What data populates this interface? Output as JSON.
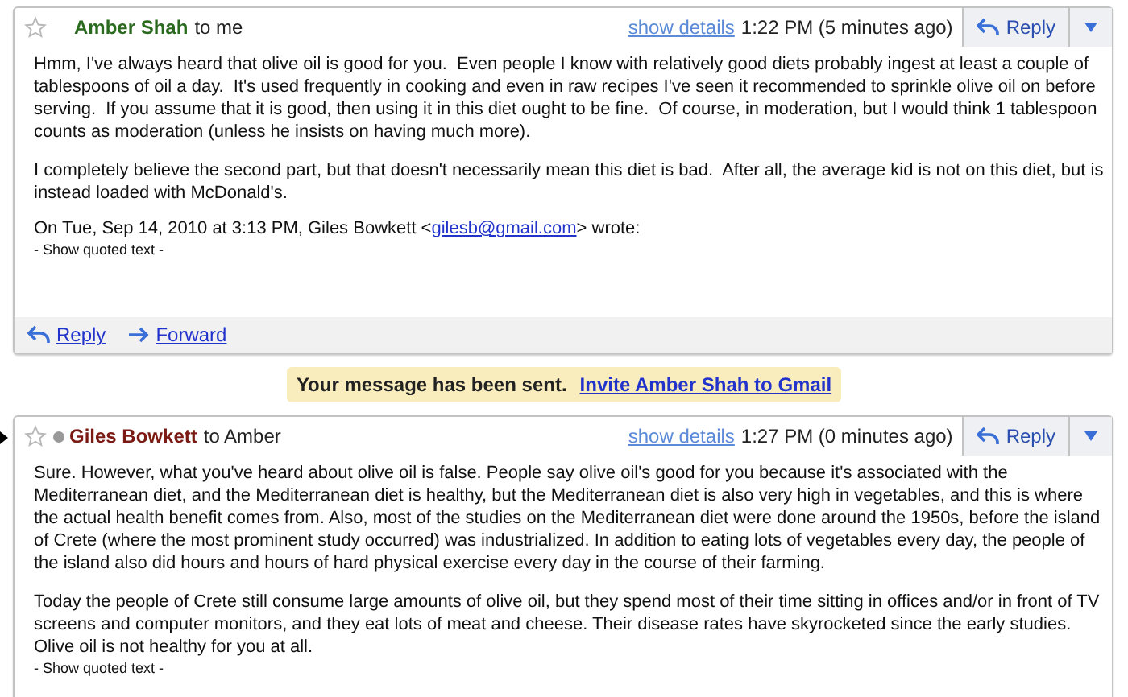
{
  "messages": [
    {
      "sender": "Amber Shah",
      "color": "#2a6a1e",
      "recipient": "to me",
      "starred": false,
      "current": false,
      "presence": false,
      "show_details": "show details",
      "time": "1:22 PM (5 minutes ago)",
      "reply_button": "Reply",
      "paragraphs": [
        "Hmm, I've always heard that olive oil is good for you.  Even people I know with relatively good diets probably ingest at least a couple of tablespoons of oil a day.  It's used frequently in cooking and even in raw recipes I've seen it recommended to sprinkle olive oil on before serving.  If you assume that it is good, then using it in this diet ought to be fine.  Of course, in moderation, but I would think 1 tablespoon counts as moderation (unless he insists on having much more).",
        "I completely believe the second part, but that doesn't necessarily mean this diet is bad.  After all, the average kid is not on this diet, but is instead loaded with McDonald's."
      ],
      "attribution": {
        "before": "On Tue, Sep 14, 2010 at 3:13 PM, Giles Bowkett <",
        "email": "gilesb@gmail.com",
        "after": "> wrote:"
      },
      "show_quoted": "- Show quoted text -",
      "actions": [
        "Reply",
        "Forward"
      ]
    },
    {
      "sender": "Giles Bowkett",
      "color": "#7a1a12",
      "recipient": "to Amber",
      "starred": false,
      "current": true,
      "presence": true,
      "show_details": "show details",
      "time": "1:27 PM (0 minutes ago)",
      "reply_button": "Reply",
      "paragraphs": [
        "Sure. However, what you've heard about olive oil is false. People say olive oil's good for you because it's associated with the Mediterranean diet, and the Mediterranean diet is healthy, but the Mediterranean diet is also very high in vegetables, and this is where the actual health benefit comes from. Also, most of the studies on the Mediterranean diet were done around the 1950s, before the island of Crete (where the most prominent study occurred) was industrialized. In addition to eating lots of vegetables every day, the people of the island also did hours and hours of hard physical exercise every day in the course of their farming.",
        "Today the people of Crete still consume large amounts of olive oil, but they spend most of their time sitting in offices and/or in front of TV screens and computer monitors, and they eat lots of meat and cheese. Their disease rates have skyrocketed since the early studies. Olive oil is not healthy for you at all."
      ],
      "show_quoted": "- Show quoted text -"
    }
  ],
  "notice": {
    "text": "Your message has been sent.",
    "link": "Invite Amber Shah to Gmail"
  }
}
